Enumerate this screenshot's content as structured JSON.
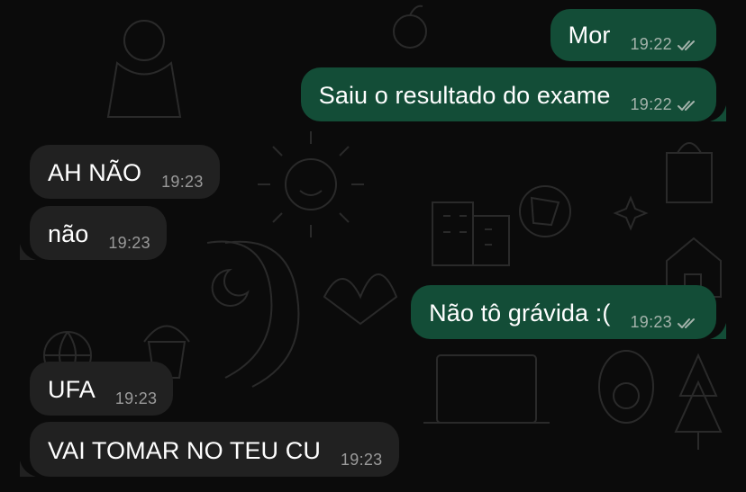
{
  "chat": {
    "wallpaper": "doodle-pattern",
    "colors": {
      "background": "#0b0b0b",
      "outgoing_bubble": "#134d37",
      "incoming_bubble": "#212121",
      "text": "#ffffff",
      "timestamp": "#a4b3ab"
    },
    "messages": [
      {
        "direction": "outgoing",
        "text": "Mor",
        "time": "19:22",
        "status": "double-check-read-icon"
      },
      {
        "direction": "outgoing",
        "text": "Saiu o resultado do exame",
        "time": "19:22",
        "status": "double-check-read-icon"
      },
      {
        "direction": "incoming",
        "text": "AH NÃO",
        "time": "19:23"
      },
      {
        "direction": "incoming",
        "text": "não",
        "time": "19:23"
      },
      {
        "direction": "outgoing",
        "text": "Não tô grávida :(",
        "time": "19:23",
        "status": "double-check-read-icon"
      },
      {
        "direction": "incoming",
        "text": "UFA",
        "time": "19:23"
      },
      {
        "direction": "incoming",
        "text": "VAI TOMAR NO TEU CU",
        "time": "19:23"
      }
    ]
  }
}
